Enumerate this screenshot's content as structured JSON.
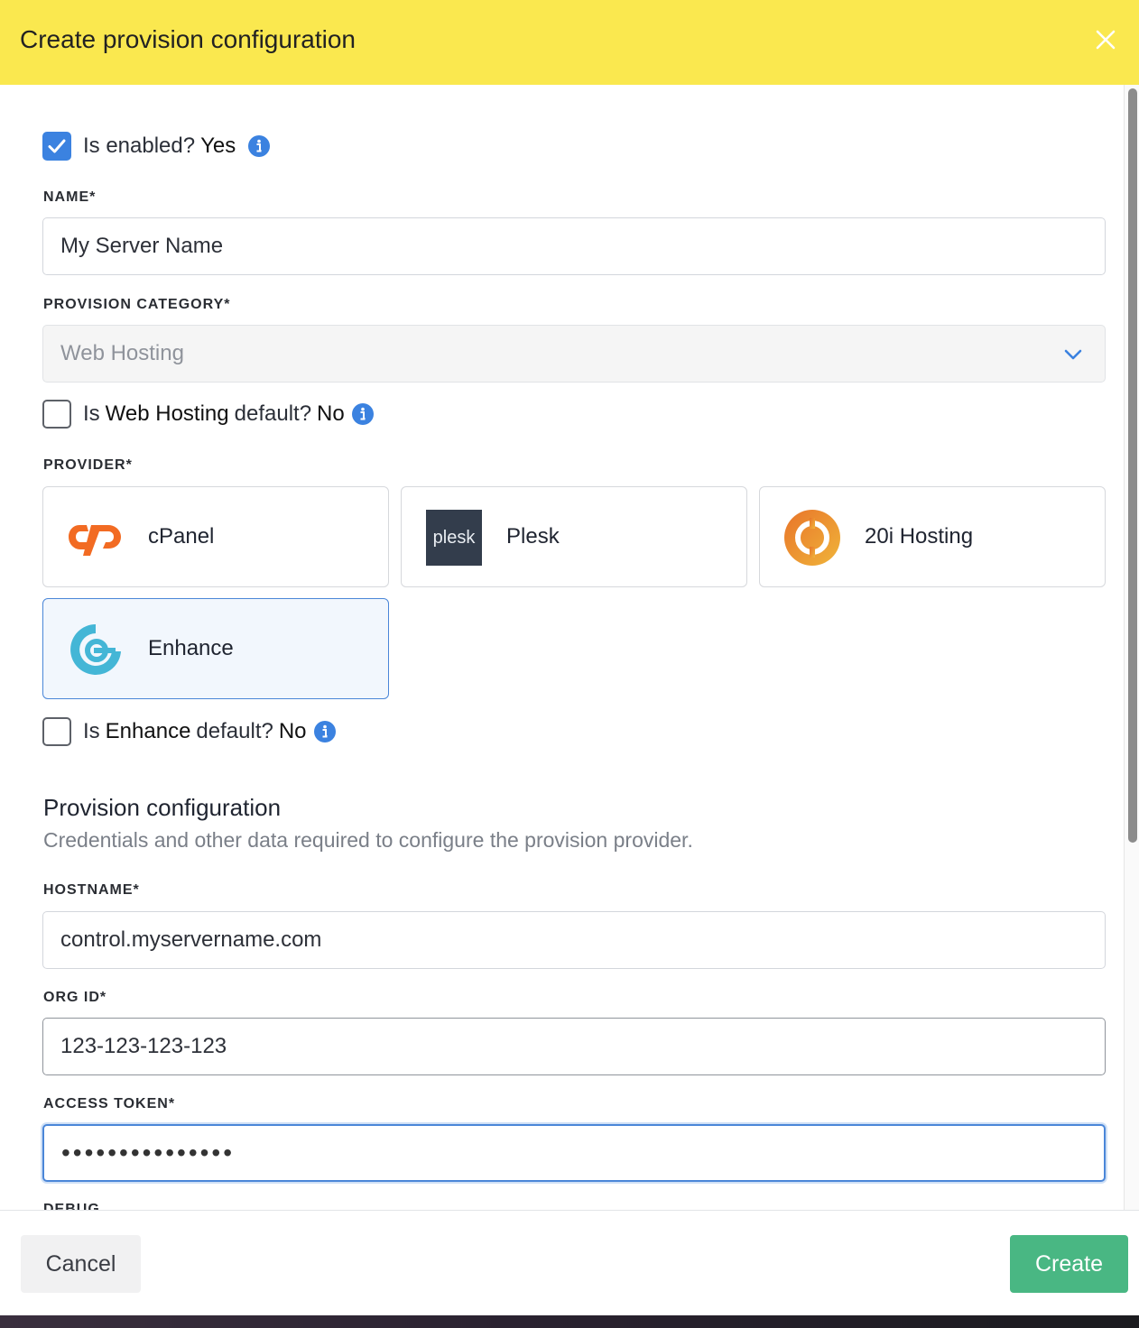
{
  "header": {
    "title": "Create provision configuration",
    "close_icon": "close-icon"
  },
  "enabled": {
    "prefix": "Is enabled?",
    "value": "Yes",
    "checked": true
  },
  "name_field": {
    "label": "NAME*",
    "value": "My Server Name"
  },
  "category_field": {
    "label": "PROVISION CATEGORY*",
    "value": "Web Hosting"
  },
  "category_default": {
    "prefix": "Is",
    "name": "Web Hosting",
    "middle": "default?",
    "value": "No",
    "checked": false
  },
  "provider": {
    "label": "PROVIDER*",
    "options": [
      {
        "name": "cPanel",
        "icon": "cpanel-logo",
        "selected": false
      },
      {
        "name": "Plesk",
        "icon": "plesk-logo",
        "logo_text": "plesk",
        "selected": false
      },
      {
        "name": "20i Hosting",
        "icon": "20i-logo",
        "selected": false
      },
      {
        "name": "Enhance",
        "icon": "enhance-logo",
        "selected": true
      }
    ]
  },
  "provider_default": {
    "prefix": "Is",
    "name": "Enhance",
    "middle": "default?",
    "value": "No",
    "checked": false
  },
  "config_section": {
    "title": "Provision configuration",
    "description": "Credentials and other data required to configure the provision provider."
  },
  "hostname_field": {
    "label": "HOSTNAME*",
    "value": "control.myservername.com"
  },
  "org_id_field": {
    "label": "ORG ID*",
    "value": "123-123-123-123"
  },
  "access_token_field": {
    "label": "ACCESS TOKEN*",
    "masked_value": "•••••••••••••••"
  },
  "debug_field": {
    "label": "DEBUG"
  },
  "footer": {
    "cancel_label": "Cancel",
    "create_label": "Create"
  },
  "colors": {
    "header_bg": "#fae84f",
    "accent": "#3b82e0",
    "create_button": "#49b783"
  }
}
